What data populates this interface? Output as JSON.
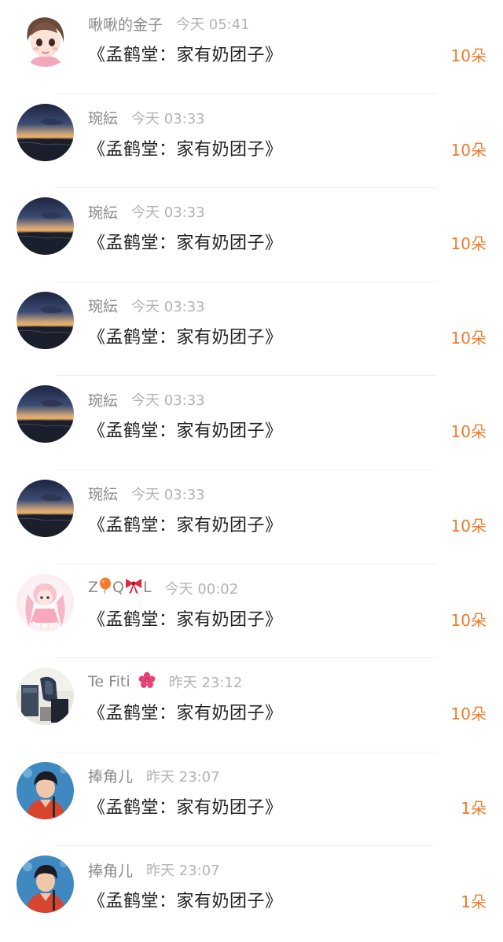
{
  "colors": {
    "name": "#8a8a8a",
    "time": "#b3b3b3",
    "title": "#222222",
    "amount": "#f07a2a",
    "divider": "#efefef"
  },
  "items": [
    {
      "name": "啾啾的金子",
      "time": "今天 05:41",
      "title": "《孟鹤堂：家有奶团子》",
      "amount": "10朵",
      "avatar": "cartoon-girl-avatar"
    },
    {
      "name": "琬紜",
      "time": "今天 03:33",
      "title": "《孟鹤堂：家有奶团子》",
      "amount": "10朵",
      "avatar": "sunset-sea-avatar"
    },
    {
      "name": "琬紜",
      "time": "今天 03:33",
      "title": "《孟鹤堂：家有奶团子》",
      "amount": "10朵",
      "avatar": "sunset-sea-avatar"
    },
    {
      "name": "琬紜",
      "time": "今天 03:33",
      "title": "《孟鹤堂：家有奶团子》",
      "amount": "10朵",
      "avatar": "sunset-sea-avatar"
    },
    {
      "name": "琬紜",
      "time": "今天 03:33",
      "title": "《孟鹤堂：家有奶团子》",
      "amount": "10朵",
      "avatar": "sunset-sea-avatar"
    },
    {
      "name": "琬紜",
      "time": "今天 03:33",
      "title": "《孟鹤堂：家有奶团子》",
      "amount": "10朵",
      "avatar": "sunset-sea-avatar"
    },
    {
      "name_parts": [
        "Z",
        "Q",
        "L"
      ],
      "name_icons": [
        "balloon-icon",
        "bow-icon"
      ],
      "time": "今天 00:02",
      "title": "《孟鹤堂：家有奶团子》",
      "amount": "10朵",
      "avatar": "anime-girl-avatar"
    },
    {
      "name": "Te Fiti",
      "name_icons": [
        "hibiscus-icon"
      ],
      "time": "昨天 23:12",
      "title": "《孟鹤堂：家有奶团子》",
      "amount": "10朵",
      "avatar": "room-photo-avatar"
    },
    {
      "name": "捧角儿",
      "time": "昨天 23:07",
      "title": "《孟鹤堂：家有奶团子》",
      "amount": "1朵",
      "avatar": "performer-avatar"
    },
    {
      "name": "捧角儿",
      "time": "昨天 23:07",
      "title": "《孟鹤堂：家有奶团子》",
      "amount": "1朵",
      "avatar": "performer-avatar"
    }
  ]
}
